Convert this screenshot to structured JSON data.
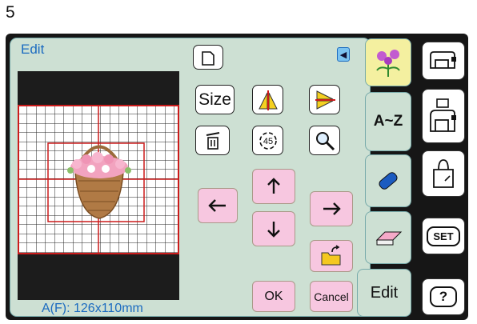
{
  "page_number": "5",
  "screen": {
    "title": "Edit",
    "pattern_info": "A(F): 126x110mm"
  },
  "buttons": {
    "size_label": "Size",
    "rotate_label": "45",
    "ok_label": "OK",
    "cancel_label": "Cancel"
  },
  "tabs": {
    "letters_label": "A~Z",
    "edit_label": "Edit"
  },
  "side_buttons": {
    "set_label": "SET",
    "help_label": "?"
  },
  "colors": {
    "panel": "#cde0d3",
    "accent_text": "#1b6bc0",
    "arrow_buttons": "#f7c7e0",
    "guide_lines": "#cc1b1b"
  }
}
